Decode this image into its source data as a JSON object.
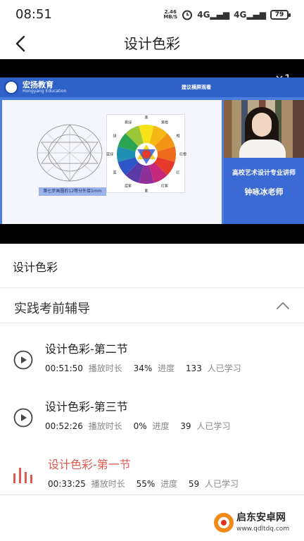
{
  "status_bar": {
    "time": "08:51",
    "net_speed_value": "2.46",
    "net_speed_unit": "MB/S",
    "signal_1": "4G",
    "signal_2": "4G",
    "battery": "79"
  },
  "header": {
    "title": "设计色彩"
  },
  "player": {
    "speed": "×1",
    "logo_text": "宏扬教育",
    "logo_sub": "Hongyang Education",
    "slide_hint": "建议横屏观看",
    "caption": "第七步画圆的12等分外接1mm",
    "wheel_labels": [
      "黄",
      "黄橙",
      "橙",
      "红橙",
      "红",
      "红紫",
      "紫",
      "蓝紫",
      "蓝",
      "蓝绿",
      "绿",
      "黄绿"
    ],
    "teacher_role": "高校艺术设计专业讲师",
    "teacher_name": "钟咏冰老师"
  },
  "course": {
    "title": "设计色彩"
  },
  "section": {
    "title": "实践考前辅导"
  },
  "lessons": [
    {
      "name": "设计色彩-第二节",
      "duration": "00:51:50",
      "duration_label": "播放时长",
      "progress": "34%",
      "progress_label": "进度",
      "learners": "133",
      "learners_label": "人已学习"
    },
    {
      "name": "设计色彩-第三节",
      "duration": "00:52:26",
      "duration_label": "播放时长",
      "progress": "0%",
      "progress_label": "进度",
      "learners": "39",
      "learners_label": "人已学习"
    },
    {
      "name": "设计色彩-第一节",
      "duration": "00:33:25",
      "duration_label": "播放时长",
      "progress": "55%",
      "progress_label": "进度",
      "learners": "59",
      "learners_label": "人已学习"
    }
  ],
  "watermark": {
    "name": "启东安卓网",
    "url": "www.qdltdq.com"
  },
  "colors": {
    "accent_red": "#e05a52",
    "slide_blue": "#4a7fe0",
    "text_dark": "#222222",
    "text_gray": "#888888"
  }
}
